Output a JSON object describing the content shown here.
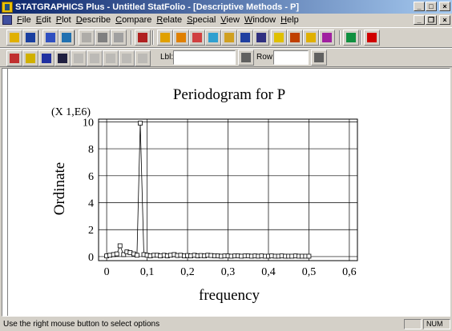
{
  "window": {
    "title": "STATGRAPHICS Plus - Untitled StatFolio - [Descriptive Methods - P]",
    "buttons": [
      "_",
      "□",
      "×"
    ]
  },
  "menu": {
    "items": [
      "File",
      "Edit",
      "Plot",
      "Describe",
      "Compare",
      "Relate",
      "Special",
      "View",
      "Window",
      "Help"
    ],
    "doc_buttons": [
      "_",
      "❐",
      "×"
    ]
  },
  "toolbar1": {
    "icons": [
      {
        "name": "open-folder-icon",
        "color": "#e0b000",
        "interactable": true
      },
      {
        "name": "save-icon",
        "color": "#1a3fa0",
        "interactable": true
      },
      {
        "name": "datasheet-icon",
        "color": "#3050c0",
        "interactable": true
      },
      {
        "name": "statfolio-icon",
        "color": "#2070b0",
        "interactable": true
      },
      {
        "name": "cut-icon",
        "color": "#808080",
        "interactable": false
      },
      {
        "name": "copy-icon",
        "color": "#808080",
        "interactable": true
      },
      {
        "name": "paste-icon",
        "color": "#a0a0a0",
        "interactable": true
      },
      {
        "name": "print-icon",
        "color": "#b02020",
        "interactable": true
      },
      {
        "name": "analysis-1-icon",
        "color": "#e0a000",
        "interactable": true
      },
      {
        "name": "analysis-2-icon",
        "color": "#e08000",
        "interactable": true
      },
      {
        "name": "analysis-3-icon",
        "color": "#d04040",
        "interactable": true
      },
      {
        "name": "analysis-4-icon",
        "color": "#30a0d0",
        "interactable": true
      },
      {
        "name": "analysis-5-icon",
        "color": "#d0a020",
        "interactable": true
      },
      {
        "name": "analysis-6-icon",
        "color": "#2040a0",
        "interactable": true
      },
      {
        "name": "analysis-7-icon",
        "color": "#303080",
        "interactable": true
      },
      {
        "name": "chart-icon",
        "color": "#e0c000",
        "interactable": true
      },
      {
        "name": "grid-icon",
        "color": "#c04000",
        "interactable": true
      },
      {
        "name": "histogram-icon",
        "color": "#e0b000",
        "interactable": true
      },
      {
        "name": "analysis-8-icon",
        "color": "#a020a0",
        "interactable": true
      },
      {
        "name": "assistant-icon",
        "color": "#109040",
        "interactable": true
      },
      {
        "name": "help-icon",
        "color": "#d00000",
        "interactable": true
      }
    ]
  },
  "toolbar2": {
    "icons": [
      {
        "name": "pane-1-icon",
        "color": "#c03030",
        "interactable": true
      },
      {
        "name": "pane-2-icon",
        "color": "#d0b000",
        "interactable": true
      },
      {
        "name": "pane-3-icon",
        "color": "#2030a0",
        "interactable": true
      },
      {
        "name": "pane-4-icon",
        "color": "#202040",
        "interactable": true
      },
      {
        "name": "pane-5-icon",
        "color": "#a0a0a0",
        "interactable": false
      },
      {
        "name": "pane-6-icon",
        "color": "#a0a0a0",
        "interactable": false
      },
      {
        "name": "pane-7-icon",
        "color": "#a0a0a0",
        "interactable": false
      },
      {
        "name": "pane-8-icon",
        "color": "#a0a0a0",
        "interactable": false
      },
      {
        "name": "pane-9-icon",
        "color": "#a0a0a0",
        "interactable": false
      }
    ],
    "lbl_label": "Lbl:",
    "lbl_value": "",
    "row_label": "Row:",
    "row_value": "",
    "binoculars_icon": "binoculars-icon"
  },
  "chart_data": {
    "type": "line",
    "title": "Periodogram for P",
    "xlabel": "frequency",
    "ylabel": "Ordinate",
    "y_multiplier_label": "(X 1,E6)",
    "xlim": [
      -0.02,
      0.62
    ],
    "ylim": [
      -0.3,
      10.2
    ],
    "x_ticks": [
      0,
      0.1,
      0.2,
      0.3,
      0.4,
      0.5,
      0.6
    ],
    "x_tick_labels": [
      "0",
      "0,1",
      "0,2",
      "0,3",
      "0,4",
      "0,5",
      "0,6"
    ],
    "y_ticks": [
      0,
      2,
      4,
      6,
      8,
      10
    ],
    "y_tick_labels": [
      "0",
      "2",
      "4",
      "6",
      "8",
      "10"
    ],
    "grid": true,
    "marker": "square",
    "series": [
      {
        "x": [
          0,
          0.008,
          0.017,
          0.025,
          0.033,
          0.042,
          0.05,
          0.058,
          0.067,
          0.075,
          0.083,
          0.092,
          0.1,
          0.108,
          0.117,
          0.125,
          0.133,
          0.142,
          0.15,
          0.158,
          0.167,
          0.175,
          0.183,
          0.192,
          0.2,
          0.208,
          0.217,
          0.225,
          0.233,
          0.242,
          0.25,
          0.258,
          0.267,
          0.275,
          0.283,
          0.292,
          0.3,
          0.308,
          0.317,
          0.325,
          0.333,
          0.342,
          0.35,
          0.358,
          0.367,
          0.375,
          0.383,
          0.392,
          0.4,
          0.408,
          0.417,
          0.425,
          0.433,
          0.442,
          0.45,
          0.458,
          0.467,
          0.475,
          0.483,
          0.492,
          0.5
        ],
        "y": [
          0.05,
          0.1,
          0.15,
          0.2,
          0.8,
          0.15,
          0.35,
          0.3,
          0.2,
          0.1,
          9.9,
          0.15,
          0.1,
          0.05,
          0.1,
          0.1,
          0.05,
          0.1,
          0.05,
          0.1,
          0.15,
          0.08,
          0.1,
          0.05,
          0.08,
          0.05,
          0.1,
          0.05,
          0.08,
          0.05,
          0.1,
          0.08,
          0.05,
          0.05,
          0.03,
          0.05,
          0.05,
          0.03,
          0.05,
          0.05,
          0.03,
          0.05,
          0.05,
          0.03,
          0.05,
          0.03,
          0.05,
          0.03,
          0.03,
          0.05,
          0.03,
          0.03,
          0.05,
          0.03,
          0.03,
          0.03,
          0.05,
          0.03,
          0.03,
          0.03,
          0.03
        ]
      }
    ]
  },
  "status": {
    "text": "Use the right mouse button to select options",
    "num": "NUM"
  }
}
